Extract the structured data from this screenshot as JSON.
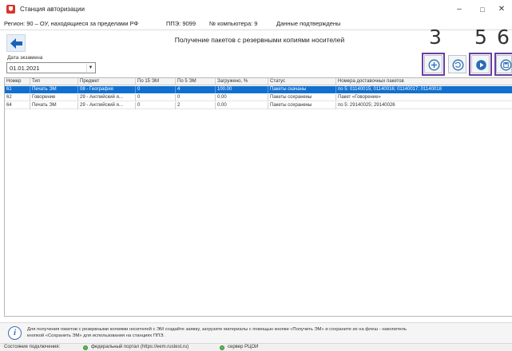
{
  "window": {
    "title": "Станция авторизации",
    "minimize": "–",
    "maximize": "□",
    "close": "✕"
  },
  "info": {
    "region": "Регион: 90 – ОУ, находящиеся за пределами РФ",
    "ppe": "ППЭ: 9099",
    "computer": "№ компьютера: 9",
    "status": "Данные подтверждены"
  },
  "page": {
    "title": "Получение пакетов с резервными копиями носителей"
  },
  "exam_date": {
    "label": "Дата экзамена",
    "value": "01.01.2021"
  },
  "annotations": {
    "a3": "3",
    "a5": "5",
    "a6": "6"
  },
  "table": {
    "headers": [
      "Номер",
      "Тип",
      "Предмет",
      "По 15 ЭМ",
      "По 5 ЭМ",
      "Загружено, %",
      "Статус",
      "Номера доставочных пакетов"
    ],
    "rows": [
      [
        "61",
        "Печать ЭМ",
        "08 - География",
        "0",
        "4",
        "100.00",
        "Пакеты скачаны",
        "по 5: 01140015; 01140016; 01140017; 01140018"
      ],
      [
        "62",
        "Говорение",
        "29 - Английский я...",
        "0",
        "0",
        "0.00",
        "Пакеты сохранены",
        "Пакет «Говорение»"
      ],
      [
        "64",
        "Печать ЭМ",
        "29 - Английский я...",
        "0",
        "2",
        "0.00",
        "Пакеты сохранены",
        "по 5: 29140025; 29140026"
      ]
    ]
  },
  "help": {
    "line1": "Для получения пакетов с резервными копиями носителей с ЭМ создайте заявку, загрузите материалы с помощью кнопки «Получить ЭМ» и сохраните их на флеш - накопитель",
    "line2": "кнопкой «Сохранить ЭМ» для использования на станциях ППЭ."
  },
  "statusbar": {
    "label": "Состояние подключения:",
    "portal": "федеральный портал (https://eem.rustest.ru)",
    "server": "сервер РЦОИ"
  },
  "colors": {
    "selected_row": "#1170cf",
    "annotation_box": "#6a3fa0",
    "ok_indicator": "#5bb85b"
  }
}
